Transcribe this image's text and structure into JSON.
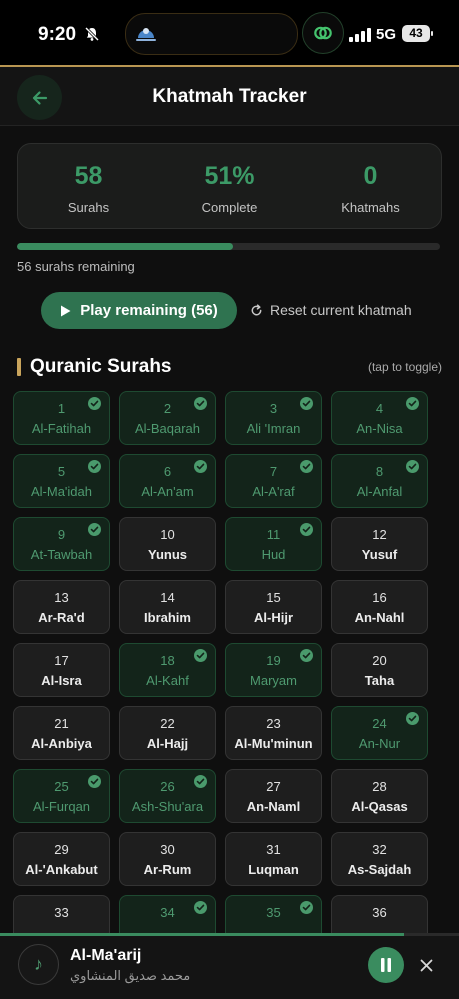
{
  "status_bar": {
    "time": "9:20",
    "network": "5G",
    "battery": "43"
  },
  "header": {
    "title": "Khatmah Tracker"
  },
  "stats": [
    {
      "value": "58",
      "label": "Surahs"
    },
    {
      "value": "51%",
      "label": "Complete"
    },
    {
      "value": "0",
      "label": "Khatmahs"
    }
  ],
  "progress": {
    "fraction": 0.51
  },
  "remaining_text": "56 surahs remaining",
  "actions": {
    "play_label": "Play remaining (56)",
    "reset_label": "Reset current khatmah"
  },
  "section": {
    "title": "Quranic Surahs",
    "hint": "(tap to toggle)"
  },
  "surahs": [
    {
      "num": "1",
      "name": "Al-Fatihah",
      "done": true
    },
    {
      "num": "2",
      "name": "Al-Baqarah",
      "done": true
    },
    {
      "num": "3",
      "name": "Ali 'Imran",
      "done": true
    },
    {
      "num": "4",
      "name": "An-Nisa",
      "done": true
    },
    {
      "num": "5",
      "name": "Al-Ma'idah",
      "done": true
    },
    {
      "num": "6",
      "name": "Al-An'am",
      "done": true
    },
    {
      "num": "7",
      "name": "Al-A'raf",
      "done": true
    },
    {
      "num": "8",
      "name": "Al-Anfal",
      "done": true
    },
    {
      "num": "9",
      "name": "At-Tawbah",
      "done": true
    },
    {
      "num": "10",
      "name": "Yunus",
      "done": false
    },
    {
      "num": "11",
      "name": "Hud",
      "done": true
    },
    {
      "num": "12",
      "name": "Yusuf",
      "done": false
    },
    {
      "num": "13",
      "name": "Ar-Ra'd",
      "done": false
    },
    {
      "num": "14",
      "name": "Ibrahim",
      "done": false
    },
    {
      "num": "15",
      "name": "Al-Hijr",
      "done": false
    },
    {
      "num": "16",
      "name": "An-Nahl",
      "done": false
    },
    {
      "num": "17",
      "name": "Al-Isra",
      "done": false
    },
    {
      "num": "18",
      "name": "Al-Kahf",
      "done": true
    },
    {
      "num": "19",
      "name": "Maryam",
      "done": true
    },
    {
      "num": "20",
      "name": "Taha",
      "done": false
    },
    {
      "num": "21",
      "name": "Al-Anbiya",
      "done": false
    },
    {
      "num": "22",
      "name": "Al-Hajj",
      "done": false
    },
    {
      "num": "23",
      "name": "Al-Mu'minun",
      "done": false
    },
    {
      "num": "24",
      "name": "An-Nur",
      "done": true
    },
    {
      "num": "25",
      "name": "Al-Furqan",
      "done": true
    },
    {
      "num": "26",
      "name": "Ash-Shu'ara",
      "done": true
    },
    {
      "num": "27",
      "name": "An-Naml",
      "done": false
    },
    {
      "num": "28",
      "name": "Al-Qasas",
      "done": false
    },
    {
      "num": "29",
      "name": "Al-'Ankabut",
      "done": false
    },
    {
      "num": "30",
      "name": "Ar-Rum",
      "done": false
    },
    {
      "num": "31",
      "name": "Luqman",
      "done": false
    },
    {
      "num": "32",
      "name": "As-Sajdah",
      "done": false
    },
    {
      "num": "33",
      "name": "",
      "done": false
    },
    {
      "num": "34",
      "name": "",
      "done": true
    },
    {
      "num": "35",
      "name": "",
      "done": true
    },
    {
      "num": "36",
      "name": "",
      "done": false
    }
  ],
  "player": {
    "title": "Al-Ma'arij",
    "reciter": "محمد صديق المنشاوي",
    "progress": 0.88
  },
  "icons": {
    "back": "arrow-left-icon",
    "bell": "bell-off-icon",
    "check": "check-icon",
    "reset": "refresh-icon",
    "play": "play-icon",
    "pause": "pause-icon",
    "close": "close-icon",
    "music": "music-note-icon"
  },
  "colors": {
    "accent": "#3c9a67",
    "gold": "#c9a45c",
    "background": "#0f0f0f"
  }
}
